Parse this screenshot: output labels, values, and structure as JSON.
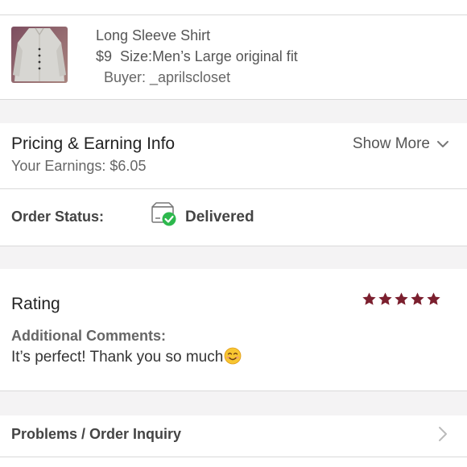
{
  "item": {
    "title": "Long Sleeve Shirt",
    "price": "$9",
    "size": "Size:Men’s Large original fit",
    "buyer": "Buyer: _aprilscloset",
    "thumbnail_icon": "shirt-photo"
  },
  "pricing": {
    "title": "Pricing & Earning Info",
    "earnings": "Your Earnings: $6.05",
    "show_more": "Show More",
    "show_more_icon": "chevron-down-icon"
  },
  "order_status": {
    "label": "Order Status:",
    "value": "Delivered",
    "icon": "delivered-box-icon",
    "check_color": "#2db84d"
  },
  "rating": {
    "title": "Rating",
    "stars": 5,
    "max_stars": 5,
    "star_color": "#7b1f2e",
    "comments_label": "Additional Comments:",
    "comments_text": "It’s perfect! Thank you so much"
  },
  "problems": {
    "label": "Problems / Order Inquiry",
    "icon": "chevron-right-icon"
  }
}
